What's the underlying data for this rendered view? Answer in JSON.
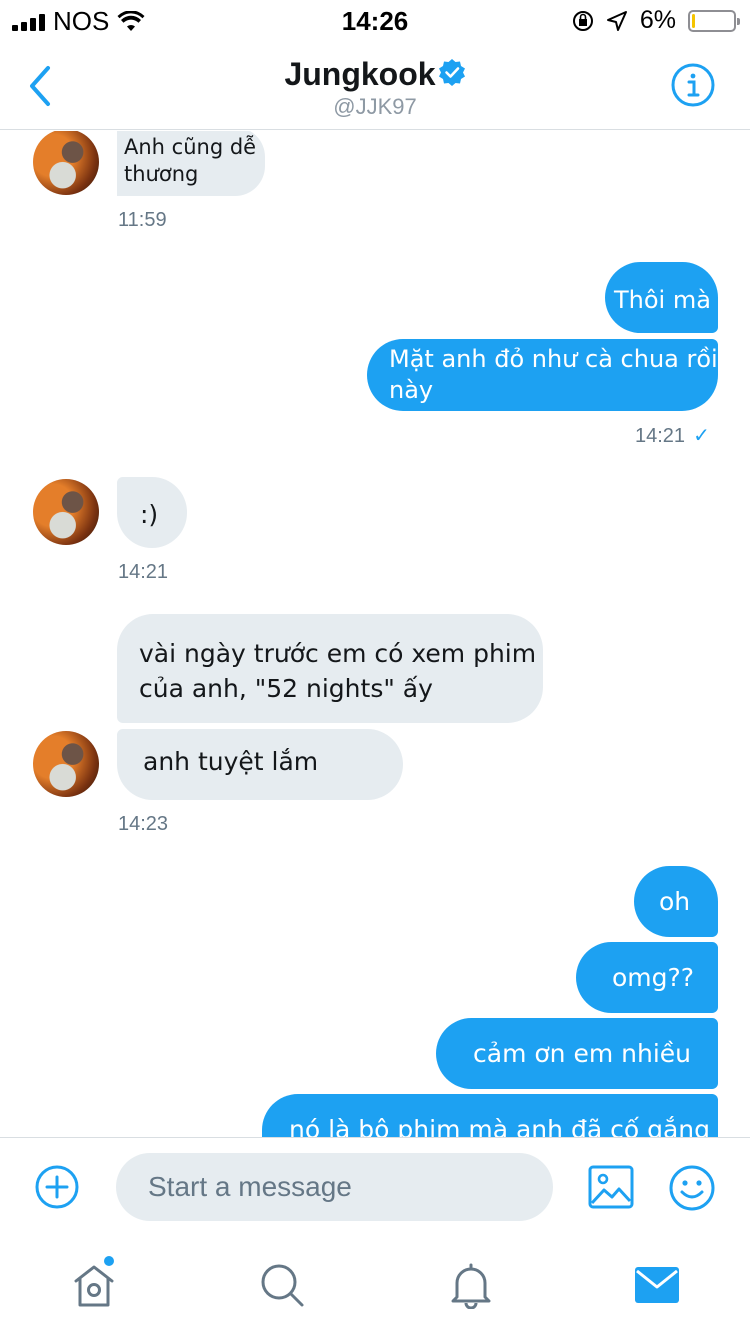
{
  "status_bar": {
    "carrier": "NOS",
    "time": "14:26",
    "battery_percent": "6%",
    "battery_level": 0.06
  },
  "header": {
    "name": "Jungkook",
    "handle": "@JJK97"
  },
  "messages": [
    {
      "dir": "in",
      "text": "Anh cũng dễ\nthương"
    },
    {
      "dir": "meta",
      "text": "11:59"
    },
    {
      "dir": "out",
      "text": "Thôi mà"
    },
    {
      "dir": "out",
      "text": "Mặt anh đỏ như cà chua rồi\nnày"
    },
    {
      "dir": "meta",
      "text": "14:21 ✓"
    },
    {
      "dir": "in",
      "text": ":)"
    },
    {
      "dir": "meta",
      "text": "14:21"
    },
    {
      "dir": "in",
      "text": "vài ngày trước em có xem phim\n của anh, \"52 nights\" ấy"
    },
    {
      "dir": "in",
      "text": "anh tuyệt lắm"
    },
    {
      "dir": "meta",
      "text": "14:23"
    },
    {
      "dir": "out",
      "text": "oh"
    },
    {
      "dir": "out",
      "text": "omg??"
    },
    {
      "dir": "out",
      "text": "cảm ơn em nhiều"
    },
    {
      "dir": "out",
      "text": "nó là bộ phim mà anh đã cố gắng"
    }
  ],
  "composer": {
    "placeholder": "Start a message"
  },
  "tabbar": {
    "items": [
      "home-icon",
      "search-icon",
      "notifications-icon",
      "messages-icon"
    ],
    "home_has_dot": true
  },
  "colors": {
    "accent": "#1da1f2",
    "incoming_bubble": "#e6ecf0",
    "timestamp": "#657786"
  }
}
